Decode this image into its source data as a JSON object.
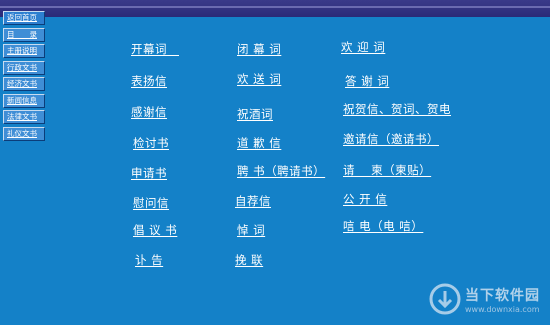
{
  "nav": [
    "返回首页",
    "目　　录",
    "主册说明",
    "行政文书",
    "经济文书",
    "新闻信息",
    "法律文书",
    "礼仪文书"
  ],
  "links": [
    [
      "开幕词　",
      "闭 幕 词",
      "欢 迎 词"
    ],
    [
      "表扬信",
      "欢 送 词",
      "答 谢 词"
    ],
    [
      "感谢信",
      "祝酒词",
      "祝贺信、贺词、贺电"
    ],
    [
      "检讨书",
      "道 歉 信",
      "邀请信（邀请书）"
    ],
    [
      "申请书",
      "聘 书（聘请书）",
      "请　 柬（柬贴）"
    ],
    [
      "慰问信",
      "自荐信",
      "公 开 信"
    ],
    [
      "倡 议 书",
      "悼 词",
      "唁 电（电 唁）"
    ],
    [
      "讣 告",
      "挽 联",
      ""
    ]
  ],
  "watermark": {
    "title": "当下软件园",
    "url": "www.downxia.com"
  }
}
